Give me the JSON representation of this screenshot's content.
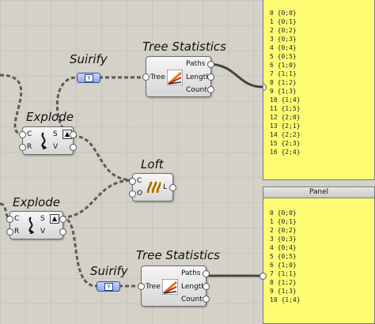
{
  "components": {
    "suirify_top": {
      "title": "Suirify"
    },
    "suirify_bottom": {
      "title": "Suirify"
    },
    "tree_stats_top": {
      "title": "Tree Statistics",
      "input": "Tree",
      "outputs": [
        "Paths",
        "Length",
        "Count"
      ]
    },
    "tree_stats_bottom": {
      "title": "Tree Statistics",
      "input": "Tree",
      "outputs": [
        "Paths",
        "Length",
        "Count"
      ]
    },
    "explode_top": {
      "title": "Explode",
      "inputs": [
        "C",
        "R"
      ],
      "outputs": [
        "S",
        "V"
      ]
    },
    "explode_bottom": {
      "title": "Explode",
      "inputs": [
        "C",
        "R"
      ],
      "outputs": [
        "S",
        "V"
      ]
    },
    "loft": {
      "title": "Loft",
      "inputs": [
        "C",
        "O"
      ],
      "outputs": [
        "L"
      ]
    }
  },
  "panel_top": {
    "rows": [
      "0 {0;0}",
      "1 {0;1}",
      "2 {0;2}",
      "3 {0;3}",
      "4 {0;4}",
      "5 {0;5}",
      "6 {1;0}",
      "7 {1;1}",
      "8 {1;2}",
      "9 {1;3}",
      "10 {1;4}",
      "11 {1;5}",
      "12 {2;0}",
      "13 {2;1}",
      "14 {2;2}",
      "15 {2;3}",
      "16 {2;4}"
    ]
  },
  "panel_bottom": {
    "header": "Panel",
    "rows": [
      "0 {0;0}",
      "1 {0;1}",
      "2 {0;2}",
      "3 {0;3}",
      "4 {0;4}",
      "5 {0;5}",
      "6 {1;0}",
      "7 {1;1}",
      "8 {1;2}",
      "9 {1;3}",
      "10 {1;4}"
    ]
  },
  "colors": {
    "canvas": "#d4d1c8",
    "panel": "#fdfc72",
    "wire": "#5b5b5b",
    "param": "#8fa7e9"
  }
}
